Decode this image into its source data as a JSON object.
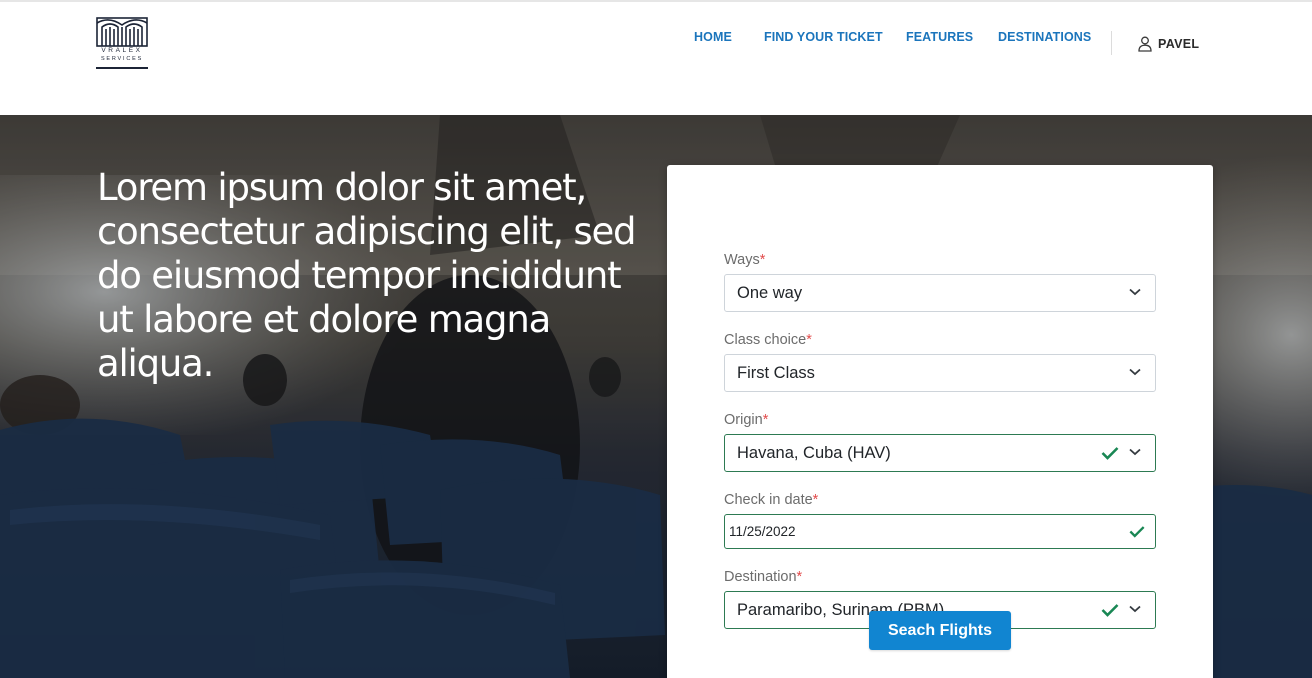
{
  "brand": {
    "name": "VRALEX",
    "tagline": "SERVICES",
    "logo_icon": "building-arches-logo"
  },
  "nav": {
    "items": [
      {
        "label": "HOME"
      },
      {
        "label": "FIND YOUR TICKET"
      },
      {
        "label": "FEATURES"
      },
      {
        "label": "DESTINATIONS"
      }
    ],
    "user": {
      "icon": "user-icon",
      "name": "PAVEL"
    }
  },
  "hero": {
    "headline": "Lorem ipsum dolor sit amet, consectetur adipiscing elit, sed do eiusmod tempor incididunt ut labore et dolore magna aliqua.",
    "background": "airplane cabin interior"
  },
  "search_form": {
    "ways": {
      "label": "Ways",
      "required": "*",
      "value": "One way"
    },
    "class_choice": {
      "label": "Class choice",
      "required": "*",
      "value": "First Class"
    },
    "origin": {
      "label": "Origin",
      "required": "*",
      "value": "Havana, Cuba (HAV)"
    },
    "check_in": {
      "label": "Check in date",
      "required": "*",
      "value": "11/25/2022"
    },
    "destination": {
      "label": "Destination",
      "required": "*",
      "value": "Paramaribo, Surinam (PBM)"
    },
    "submit_label": "Seach Flights"
  },
  "colors": {
    "nav_link": "#1b75bc",
    "button": "#1185d1",
    "valid_border": "#2d7a52",
    "required_star": "#e24b4b"
  }
}
